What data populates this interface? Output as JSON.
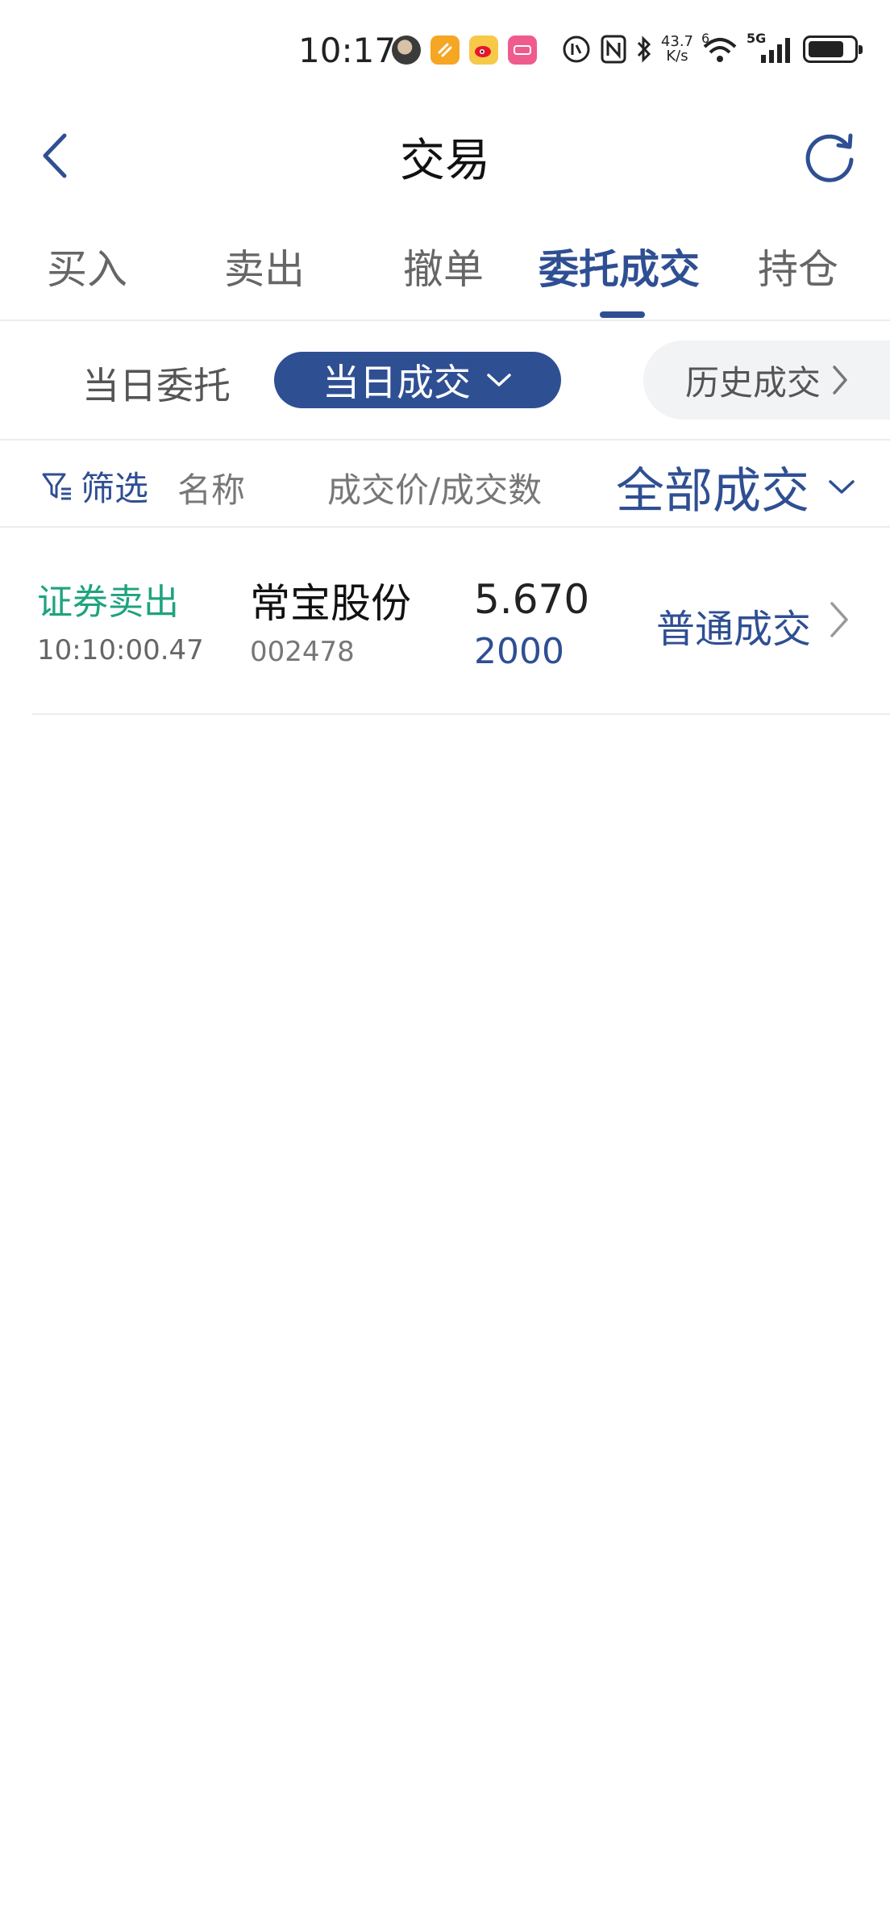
{
  "status_bar": {
    "time": "10:17",
    "net_speed_value": "43.7",
    "net_speed_unit": "K/s",
    "wifi_label": "6",
    "cellular_label": "5G",
    "battery_level_pct": 80,
    "app_icons": [
      "avatar-icon",
      "orange-app-icon",
      "weibo-icon",
      "pink-app-icon"
    ],
    "system_icons": [
      "data-saver-icon",
      "nfc-icon",
      "bluetooth-icon",
      "wifi-icon",
      "signal-icon",
      "battery-icon"
    ]
  },
  "header": {
    "title": "交易",
    "back_icon": "chevron-left-icon",
    "refresh_icon": "refresh-icon"
  },
  "tabs": [
    {
      "label": "买入",
      "active": false
    },
    {
      "label": "卖出",
      "active": false
    },
    {
      "label": "撤单",
      "active": false
    },
    {
      "label": "委托成交",
      "active": true
    },
    {
      "label": "持仓",
      "active": false
    }
  ],
  "subtabs": {
    "today_orders": "当日委托",
    "today_trades": "当日成交",
    "history_trades": "历史成交"
  },
  "filter_row": {
    "filter_label": "筛选",
    "col_name": "名称",
    "col_price_qty": "成交价/成交数",
    "scope_dropdown": "全部成交"
  },
  "trades": [
    {
      "type": "证券卖出",
      "time": "10:10:00.47",
      "name": "常宝股份",
      "code": "002478",
      "price": "5.670",
      "quantity": "2000",
      "kind": "普通成交"
    }
  ],
  "colors": {
    "accent": "#2f4f93",
    "sell_green": "#1fa37f",
    "divider": "#ececec"
  }
}
